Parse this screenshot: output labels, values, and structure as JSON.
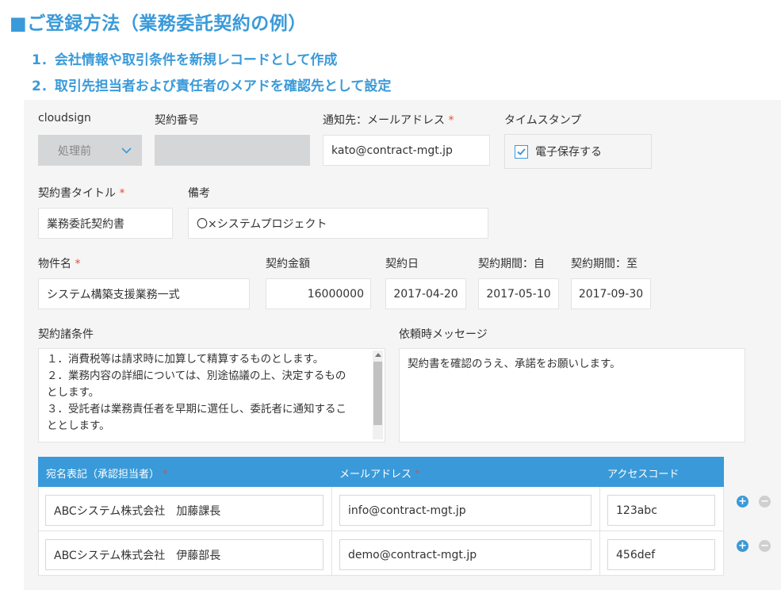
{
  "heading": {
    "title": "■ご登録方法（業務委託契約の例）",
    "step1": "1．会社情報や取引条件を新規レコードとして作成",
    "step2": "2．取引先担当者および責任者のメアドを確認先として設定"
  },
  "form": {
    "cloudsign": {
      "label": "cloudsign",
      "value": "処理前"
    },
    "contract_no": {
      "label": "契約番号",
      "value": ""
    },
    "notify": {
      "label": "通知先：メールアドレス",
      "required": "*",
      "value": "kato@contract-mgt.jp"
    },
    "timestamp": {
      "label": "タイムスタンプ",
      "checkbox_label": "電子保存する",
      "checked": true
    },
    "title": {
      "label": "契約書タイトル",
      "required": "*",
      "value": "業務委託契約書"
    },
    "remarks": {
      "label": "備考",
      "value": "〇×システムプロジェクト"
    },
    "property": {
      "label": "物件名",
      "required": "*",
      "value": "システム構築支援業務一式"
    },
    "amount": {
      "label": "契約金額",
      "value": "16000000"
    },
    "contract_date": {
      "label": "契約日",
      "value": "2017-04-20"
    },
    "period_from": {
      "label": "契約期間：自",
      "value": "2017-05-10"
    },
    "period_to": {
      "label": "契約期間：至",
      "value": "2017-09-30"
    },
    "conditions": {
      "label": "契約諸条件",
      "lines": [
        "１．消費税等は請求時に加算して精算するものとします。",
        "２．業務内容の詳細については、別途協議の上、決定するもの",
        "とします。",
        "３．受託者は業務責任者を早期に選任し、委託者に通知するこ",
        "ととします。"
      ]
    },
    "message": {
      "label": "依頼時メッセージ",
      "value": "契約書を確認のうえ、承諾をお願いします。"
    }
  },
  "table": {
    "headers": {
      "name": "宛名表記（承認担当者）",
      "email": "メールアドレス",
      "code": "アクセスコード",
      "required": "*"
    },
    "rows": [
      {
        "name": "ABCシステム株式会社　加藤課長",
        "email": "info@contract-mgt.jp",
        "code": "123abc"
      },
      {
        "name": "ABCシステム株式会社　伊藤部長",
        "email": "demo@contract-mgt.jp",
        "code": "456def"
      }
    ],
    "add_icon": "+",
    "remove_icon": "−"
  },
  "colors": {
    "accent": "#3a9ad9",
    "required": "#e74c3c",
    "panel": "#f5f5f5"
  }
}
